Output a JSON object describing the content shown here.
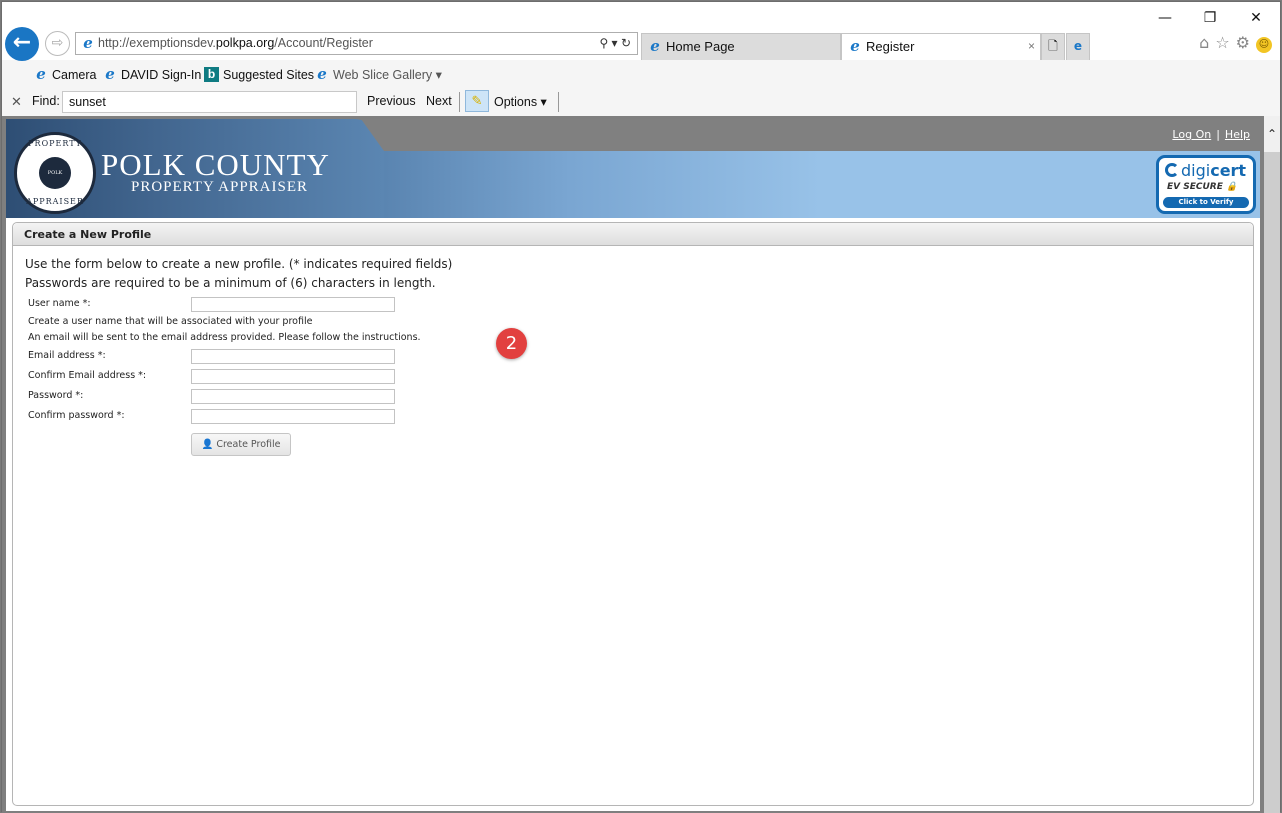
{
  "browser": {
    "window_controls": {
      "minimize": "—",
      "restore": "❐",
      "close": "✕"
    },
    "address": {
      "prefix": "http://exemptionsdev.",
      "domain": "polkpa.org",
      "path": "/Account/Register",
      "search_glyph": "⚲ ▾",
      "refresh_glyph": "↻"
    },
    "tabs": [
      {
        "label": "Home Page",
        "active": false
      },
      {
        "label": "Register",
        "active": true
      }
    ],
    "tab_close": "×",
    "right_icons": {
      "home": "⌂",
      "favorites": "☆",
      "settings": "⚙",
      "smiley": "☺"
    },
    "favorites": [
      {
        "label": "Camera",
        "icon": "ie-icon"
      },
      {
        "label": "DAVID Sign-In",
        "icon": "ie-icon"
      },
      {
        "label": "Suggested Sites",
        "icon": "bing-icon"
      },
      {
        "label": "Web Slice Gallery ▾",
        "icon": "ie-icon"
      }
    ],
    "find": {
      "close": "✕",
      "label": "Find:",
      "value": "sunset",
      "previous": "Previous",
      "next": "Next",
      "options": "Options ▾"
    }
  },
  "site": {
    "title": "POLK COUNTY",
    "subtitle": "PROPERTY APPRAISER",
    "seal_top": "PROPERTY",
    "seal_bottom": "APPRAISER",
    "seal_center": "POLK COUNTY",
    "links": {
      "log_on": "Log On",
      "separator": "|",
      "help": "Help"
    },
    "digicert": {
      "brand_a": "digi",
      "brand_b": "cert",
      "ev": "EV SECURE 🔒",
      "verify": "Click to Verify"
    }
  },
  "form": {
    "header": "Create a New Profile",
    "intro_1": "Use the form below to create a new profile. (* indicates required fields)",
    "intro_2": "Passwords are required to be a minimum of (6) characters in length.",
    "username_label": "User name *:",
    "username_value": "",
    "hint_1": "Create a user name that will be associated with your profile",
    "hint_2": "An email will be sent to the email address provided. Please follow the instructions.",
    "email_label": "Email address *:",
    "email_value": "",
    "confirm_email_label": "Confirm Email address *:",
    "confirm_email_value": "",
    "password_label": "Password *:",
    "password_value": "",
    "confirm_password_label": "Confirm password *:",
    "confirm_password_value": "",
    "submit_label": "👤 Create Profile"
  },
  "annotation_badge": "2",
  "scrollbar": {
    "up_arrow": "⌃"
  }
}
